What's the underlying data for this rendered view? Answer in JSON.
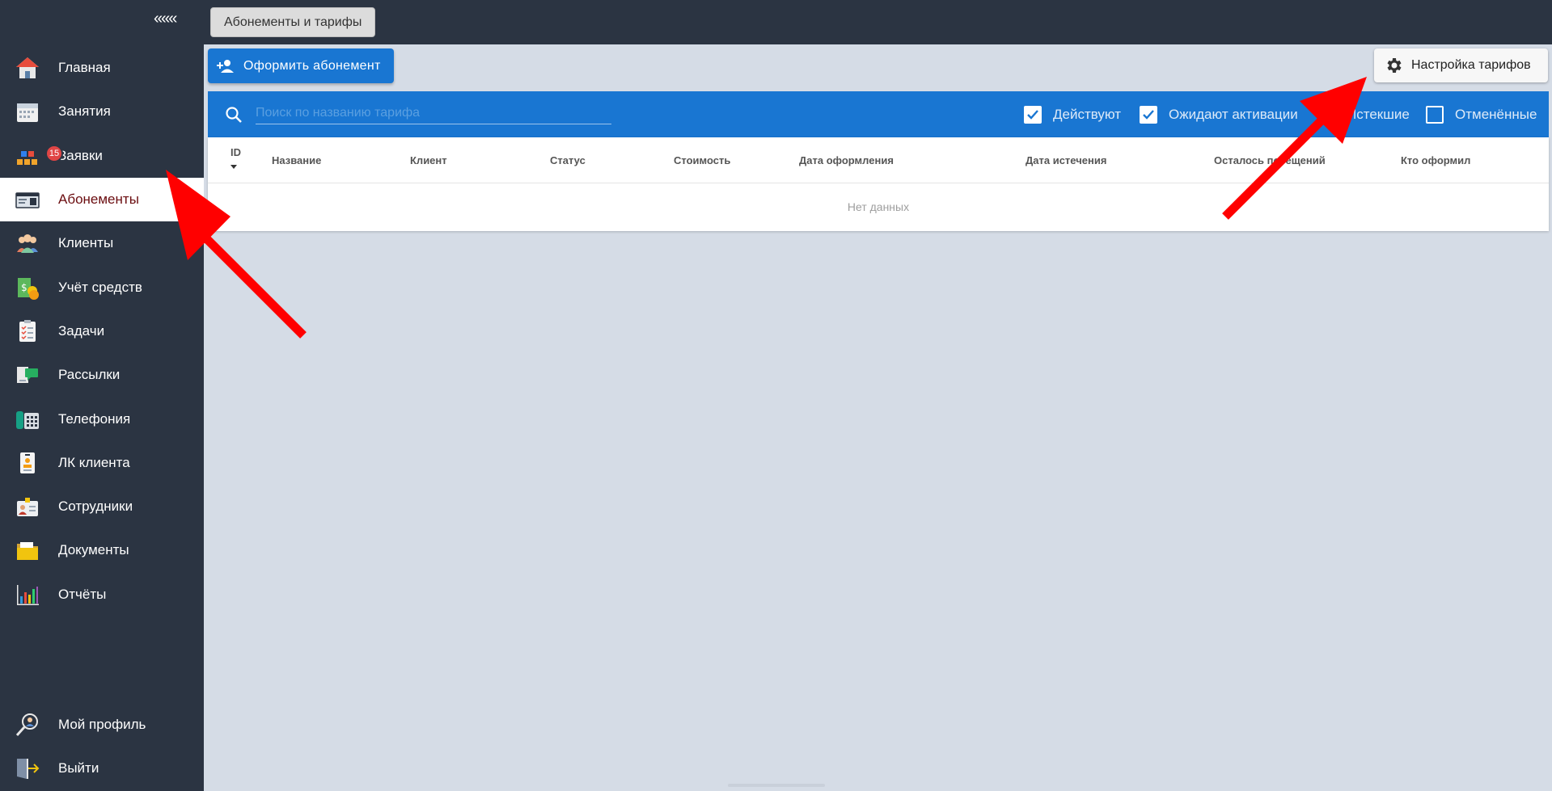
{
  "sidebar": {
    "collapse_label": "«««",
    "items": [
      {
        "label": "Главная",
        "icon": "home-icon"
      },
      {
        "label": "Занятия",
        "icon": "calendar-icon"
      },
      {
        "label": "Заявки",
        "icon": "requests-icon",
        "badge": "15"
      },
      {
        "label": "Абонементы",
        "icon": "subscriptions-icon",
        "active": true
      },
      {
        "label": "Клиенты",
        "icon": "clients-icon"
      },
      {
        "label": "Учёт средств",
        "icon": "money-icon"
      },
      {
        "label": "Задачи",
        "icon": "tasks-icon"
      },
      {
        "label": "Рассылки",
        "icon": "mailing-icon"
      },
      {
        "label": "Телефония",
        "icon": "phone-icon"
      },
      {
        "label": "ЛК клиента",
        "icon": "client-account-icon"
      },
      {
        "label": "Сотрудники",
        "icon": "staff-icon"
      },
      {
        "label": "Документы",
        "icon": "documents-icon"
      },
      {
        "label": "Отчёты",
        "icon": "reports-icon"
      }
    ],
    "bottom_items": [
      {
        "label": "Мой профиль",
        "icon": "profile-icon"
      },
      {
        "label": "Выйти",
        "icon": "logout-icon"
      }
    ]
  },
  "header": {
    "tab_label": "Абонементы и тарифы"
  },
  "toolbar": {
    "new_subscription_label": "Оформить абонемент",
    "tariff_settings_label": "Настройка тарифов"
  },
  "filters": {
    "search_placeholder": "Поиск по названию тарифа",
    "checkboxes": [
      {
        "label": "Действуют",
        "checked": true
      },
      {
        "label": "Ожидают активации",
        "checked": true
      },
      {
        "label": "Истекшие",
        "checked": false
      },
      {
        "label": "Отменённые",
        "checked": false
      }
    ]
  },
  "table": {
    "columns": [
      "ID",
      "Название",
      "Клиент",
      "Статус",
      "Стоимость",
      "Дата оформления",
      "Дата истечения",
      "Осталось посещений",
      "Кто оформил"
    ],
    "empty_text": "Нет данных"
  },
  "colors": {
    "sidebar_bg": "#2b3442",
    "primary": "#1976d2",
    "content_bg": "#d5dce6",
    "active_text": "#6b0d10",
    "annotation_arrow": "#ff0000"
  }
}
